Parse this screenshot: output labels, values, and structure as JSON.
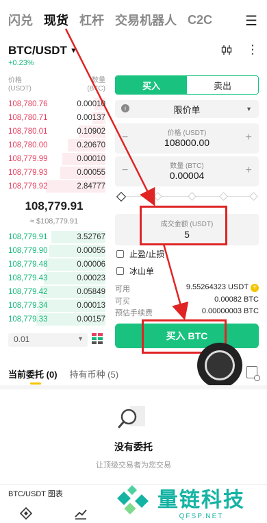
{
  "nav": {
    "tabs": [
      "闪兑",
      "现货",
      "杠杆",
      "交易机器人",
      "C2C"
    ],
    "active_index": 1
  },
  "pair": {
    "symbol": "BTC/USDT",
    "change": "+0.23%"
  },
  "orderbook": {
    "price_header": [
      "价格",
      "(USDT)"
    ],
    "qty_header": [
      "数量",
      "(BTC)"
    ],
    "asks": [
      {
        "price": "108,780.76",
        "qty": "0.00010",
        "depth": 0.1
      },
      {
        "price": "108,780.71",
        "qty": "0.00137",
        "depth": 0.12
      },
      {
        "price": "108,780.01",
        "qty": "0.10902",
        "depth": 0.25
      },
      {
        "price": "108,780.00",
        "qty": "0.20670",
        "depth": 0.35
      },
      {
        "price": "108,779.99",
        "qty": "0.00010",
        "depth": 0.4
      },
      {
        "price": "108,779.93",
        "qty": "0.00055",
        "depth": 0.42
      },
      {
        "price": "108,779.92",
        "qty": "2.84777",
        "depth": 0.55
      }
    ],
    "last_price": "108,779.91",
    "last_price_fiat": "≈ $108,779.91",
    "bids": [
      {
        "price": "108,779.91",
        "qty": "3.52767",
        "depth": 0.5
      },
      {
        "price": "108,779.90",
        "qty": "0.00055",
        "depth": 0.52
      },
      {
        "price": "108,779.48",
        "qty": "0.00006",
        "depth": 0.55
      },
      {
        "price": "108,779.43",
        "qty": "0.00023",
        "depth": 0.57
      },
      {
        "price": "108,779.42",
        "qty": "0.05849",
        "depth": 0.6
      },
      {
        "price": "108,779.34",
        "qty": "0.00013",
        "depth": 0.62
      },
      {
        "price": "108,779.33",
        "qty": "0.00157",
        "depth": 0.64
      }
    ],
    "depth_value": "0.01"
  },
  "form": {
    "buy_label": "买入",
    "sell_label": "卖出",
    "order_type": "限价单",
    "price_label": "价格 (USDT)",
    "price_value": "108000.00",
    "qty_label": "数量 (BTC)",
    "qty_value": "0.00004",
    "amount_label": "成交金额 (USDT)",
    "amount_value": "5",
    "tp_sl_label": "止盈/止损",
    "iceberg_label": "冰山单",
    "available_label": "可用",
    "available_value": "9.55264323 USDT",
    "buyable_label": "可买",
    "buyable_value": "0.00082 BTC",
    "fee_label": "预估手续费",
    "fee_value": "0.00000003 BTC",
    "submit_label": "买入 BTC"
  },
  "orders": {
    "tabs": [
      {
        "label": "当前委托",
        "count": "(0)"
      },
      {
        "label": "持有币种",
        "count": "(5)"
      }
    ],
    "empty_title": "没有委托",
    "empty_sub": "让顶级交易者为您交易"
  },
  "bottom": {
    "chart_link": "BTC/USDT 图表"
  },
  "watermark": {
    "title": "量链科技",
    "url": "QFSP.NET"
  },
  "colors": {
    "buy": "#19c27f",
    "sell": "#e4405f",
    "accent": "#f5c400",
    "annotation": "#e02424"
  }
}
